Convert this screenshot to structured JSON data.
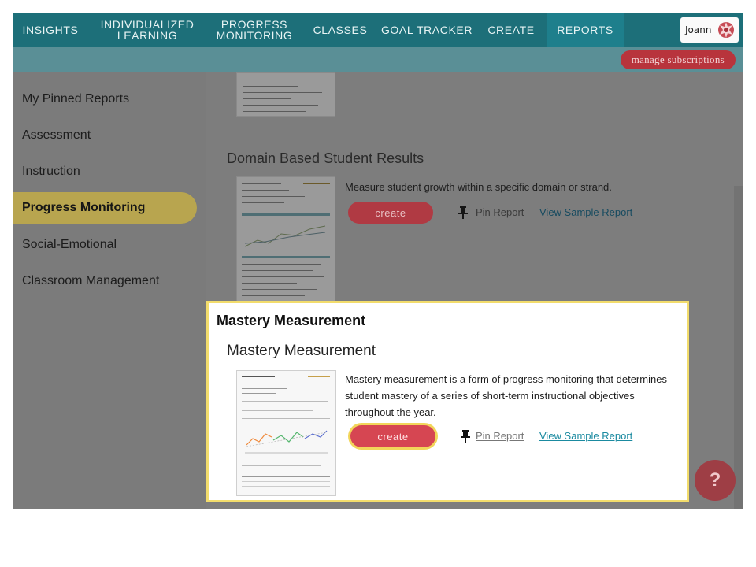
{
  "nav": {
    "items": [
      {
        "label": "INSIGHTS"
      },
      {
        "label": "INDIVIDUALIZED LEARNING"
      },
      {
        "label": "PROGRESS MONITORING"
      },
      {
        "label": "CLASSES"
      },
      {
        "label": "GOAL TRACKER"
      },
      {
        "label": "CREATE"
      },
      {
        "label": "REPORTS"
      }
    ],
    "active": "REPORTS",
    "user_name": "Joann"
  },
  "subbar": {
    "manage_label": "manage subscriptions"
  },
  "sidebar": {
    "items": [
      {
        "label": "My Pinned Reports"
      },
      {
        "label": "Assessment"
      },
      {
        "label": "Instruction"
      },
      {
        "label": "Progress Monitoring"
      },
      {
        "label": "Social-Emotional"
      },
      {
        "label": "Classroom Management"
      }
    ],
    "active": "Progress Monitoring"
  },
  "reports": [
    {
      "title": "Domain Based Student Results",
      "description": "Measure student growth within a specific domain or strand.",
      "create_label": "create",
      "pin_label": "Pin Report",
      "sample_label": "View Sample Report"
    }
  ],
  "highlight": {
    "heading": "Mastery Measurement",
    "title": "Mastery Measurement",
    "description": "Mastery measurement is a form of progress monitoring that determines student mastery of a series of short-term instructional objectives throughout the year.",
    "create_label": "create",
    "pin_label": "Pin Report",
    "sample_label": "View Sample Report"
  },
  "help": {
    "label": "?"
  },
  "colors": {
    "nav": "#1d6f79",
    "accent": "#b03a43",
    "highlight_border": "#f2dc6c",
    "link": "#1a8aa0"
  }
}
